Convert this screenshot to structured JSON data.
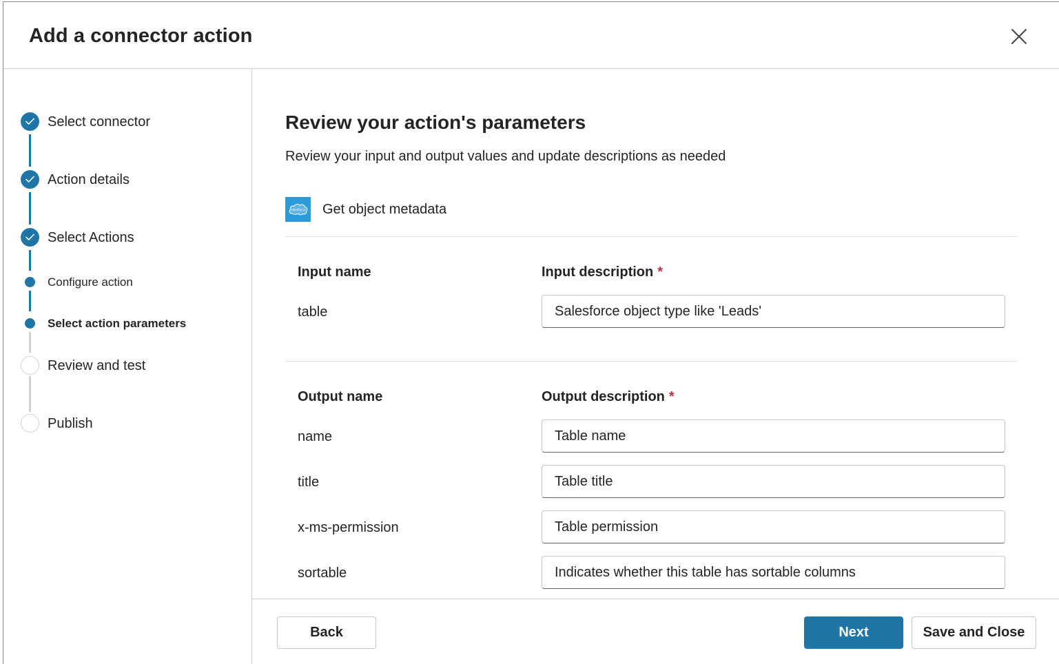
{
  "dialog": {
    "title": "Add a connector action",
    "close_icon": "close-icon"
  },
  "steps": [
    {
      "label": "Select connector",
      "state": "complete"
    },
    {
      "label": "Action details",
      "state": "complete"
    },
    {
      "label": "Select Actions",
      "state": "complete"
    },
    {
      "label": "Configure action",
      "state": "substep"
    },
    {
      "label": "Select action parameters",
      "state": "current-substep"
    },
    {
      "label": "Review and test",
      "state": "pending"
    },
    {
      "label": "Publish",
      "state": "pending"
    }
  ],
  "main": {
    "title": "Review your action's parameters",
    "subtitle": "Review your input and output values and update descriptions as needed",
    "action": {
      "name": "Get object metadata",
      "logo_text": "salesforce",
      "logo_color": "#2d9bd8"
    },
    "inputs": {
      "name_header": "Input name",
      "description_header": "Input description",
      "required_marker": "*",
      "rows": [
        {
          "name": "table",
          "description": "Salesforce object type like 'Leads'"
        }
      ]
    },
    "outputs": {
      "name_header": "Output name",
      "description_header": "Output description",
      "required_marker": "*",
      "rows": [
        {
          "name": "name",
          "description": "Table name"
        },
        {
          "name": "title",
          "description": "Table title"
        },
        {
          "name": "x-ms-permission",
          "description": "Table permission"
        },
        {
          "name": "sortable",
          "description": "Indicates whether this table has sortable columns"
        }
      ]
    }
  },
  "footer": {
    "back_label": "Back",
    "next_label": "Next",
    "save_close_label": "Save and Close"
  },
  "colors": {
    "accent": "#1f76a6",
    "required": "#c4314b"
  }
}
